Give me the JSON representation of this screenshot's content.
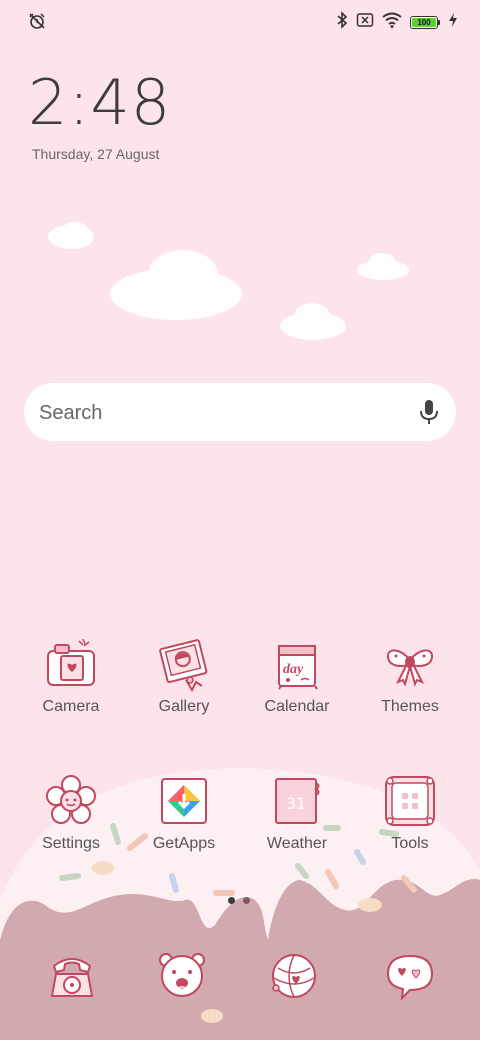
{
  "status_bar": {
    "left_icon": "alarm-off-icon",
    "right_icons": [
      "bluetooth-icon",
      "no-sim-icon",
      "wifi-icon",
      "battery-icon",
      "charging-bolt-icon"
    ],
    "battery_level": "100",
    "battery_color": "#5ed22a"
  },
  "clock": {
    "time": "2:48",
    "date": "Thursday, 27 August"
  },
  "search": {
    "placeholder": "Search",
    "icon": "mic-icon"
  },
  "apps_row1": [
    {
      "label": "Camera",
      "icon": "camera-icon"
    },
    {
      "label": "Gallery",
      "icon": "gallery-icon"
    },
    {
      "label": "Calendar",
      "icon": "calendar-icon"
    },
    {
      "label": "Themes",
      "icon": "themes-bow-icon"
    }
  ],
  "apps_row2": [
    {
      "label": "Settings",
      "icon": "settings-flower-icon"
    },
    {
      "label": "GetApps",
      "icon": "getapps-icon"
    },
    {
      "label": "Weather",
      "icon": "weather-icon",
      "badge": "31"
    },
    {
      "label": "Tools",
      "icon": "tools-folder-icon"
    }
  ],
  "page_indicator": {
    "pages": 2,
    "current": 1
  },
  "dock": [
    {
      "icon": "phone-icon"
    },
    {
      "icon": "messaging-bear-icon"
    },
    {
      "icon": "browser-globe-icon"
    },
    {
      "icon": "chat-bubble-icon"
    }
  ],
  "colors": {
    "wallpaper": "#fde3ea",
    "icon_line": "#c0485f",
    "cream": "#fdf0f3",
    "mocha": "#d1a9ae"
  }
}
